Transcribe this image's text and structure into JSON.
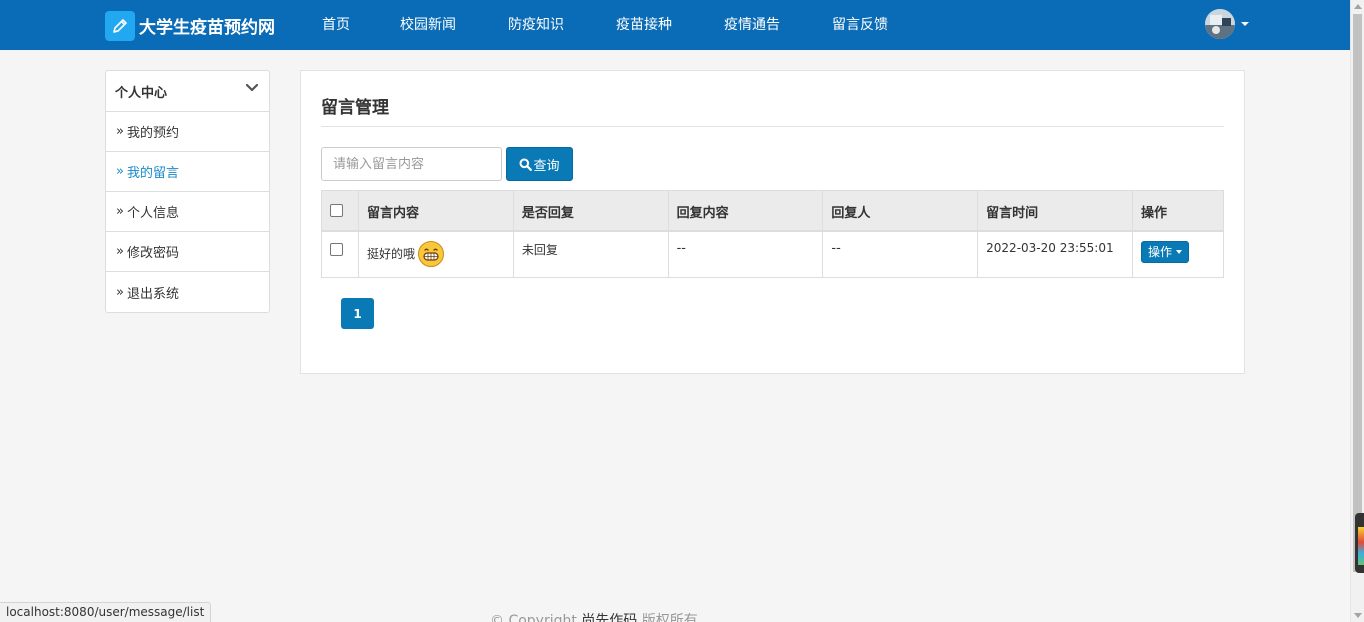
{
  "brand": {
    "title": "大学生疫苗预约网",
    "logo_icon": "pencil-icon",
    "logo_color": "#22a8f0"
  },
  "colors": {
    "navbar": "#0a6bb6",
    "primary": "#0a7ab6",
    "active_link": "#1a8bc7"
  },
  "nav": {
    "items": [
      {
        "label": "首页"
      },
      {
        "label": "校园新闻"
      },
      {
        "label": "防疫知识"
      },
      {
        "label": "疫苗接种"
      },
      {
        "label": "疫情通告"
      },
      {
        "label": "留言反馈"
      }
    ]
  },
  "sidebar": {
    "title": "个人中心",
    "items": [
      {
        "label": "我的预约",
        "active": false
      },
      {
        "label": "我的留言",
        "active": true
      },
      {
        "label": "个人信息",
        "active": false
      },
      {
        "label": "修改密码",
        "active": false
      },
      {
        "label": "退出系统",
        "active": false
      }
    ]
  },
  "main": {
    "title": "留言管理",
    "search": {
      "placeholder": "请输入留言内容",
      "value": "",
      "button_label": "查询"
    },
    "table": {
      "headers": [
        "留言内容",
        "是否回复",
        "回复内容",
        "回复人",
        "留言时间",
        "操作"
      ],
      "rows": [
        {
          "content": "挺好的哦",
          "content_icon": "grinning-emoji-icon",
          "replied": "未回复",
          "reply_content": "--",
          "replier": "--",
          "time": "2022-03-20 23:55:01",
          "action_label": "操作"
        }
      ]
    },
    "pagination": {
      "current": "1"
    }
  },
  "footer": {
    "prefix": "© Copyright ",
    "author": "尚先作码",
    "suffix": " 版权所有"
  },
  "status_url": "localhost:8080/user/message/list"
}
